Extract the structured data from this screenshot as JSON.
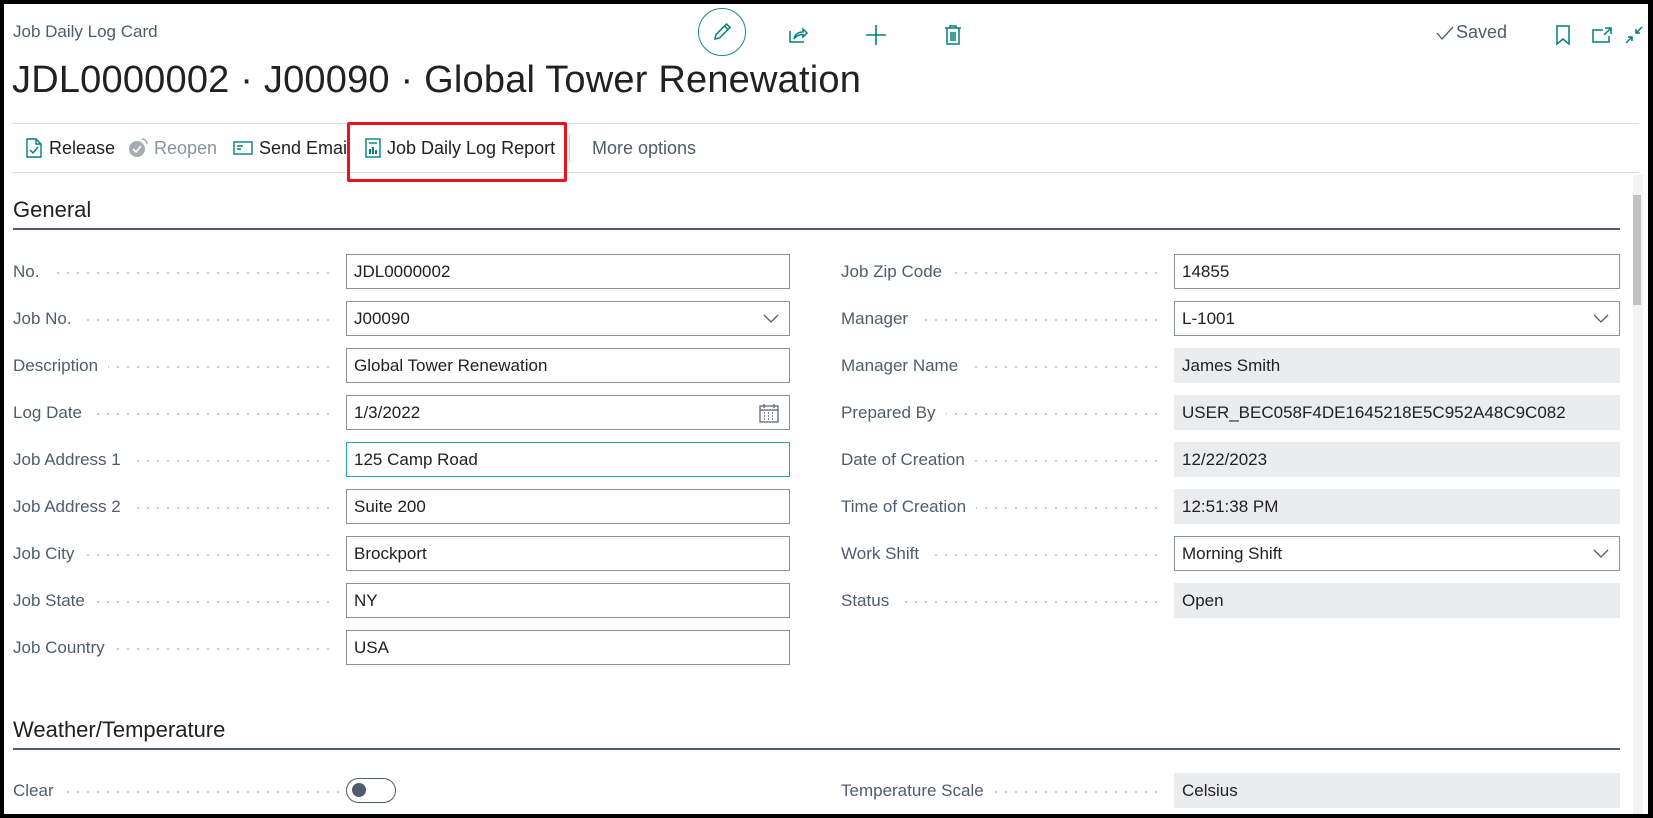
{
  "header": {
    "caption": "Job Daily Log Card",
    "title": "JDL0000002 · J00090 · Global Tower Renewation",
    "save_status": "Saved",
    "icons": {
      "edit": "pencil-icon",
      "share": "share-icon",
      "new": "plus-icon",
      "delete": "trash-icon",
      "bookmark": "bookmark-icon",
      "open_new_window": "open-in-new-window-icon",
      "collapse": "collapse-icon"
    }
  },
  "actions": [
    {
      "label": "Release",
      "icon": "release-document-icon",
      "enabled": true
    },
    {
      "label": "Reopen",
      "icon": "reopen-icon",
      "enabled": false
    },
    {
      "label": "Send Email",
      "icon": "email-icon",
      "enabled": true
    },
    {
      "label": "Job Daily Log Report",
      "icon": "report-icon",
      "enabled": true,
      "highlighted": true
    },
    {
      "label": "More options",
      "enabled": true
    }
  ],
  "highlight_color": "#e8141b",
  "accent_color": "#00807e",
  "sections": {
    "general": {
      "title": "General",
      "left_fields": [
        {
          "label": "No.",
          "value": "JDL0000002",
          "type": "text"
        },
        {
          "label": "Job No.",
          "value": "J00090",
          "type": "dropdown"
        },
        {
          "label": "Description",
          "value": "Global Tower Renewation",
          "type": "text"
        },
        {
          "label": "Log Date",
          "value": "1/3/2022",
          "type": "date"
        },
        {
          "label": "Job Address 1",
          "value": "125 Camp Road",
          "type": "text",
          "focused": true
        },
        {
          "label": "Job Address 2",
          "value": "Suite 200",
          "type": "text"
        },
        {
          "label": "Job City",
          "value": "Brockport",
          "type": "text"
        },
        {
          "label": "Job State",
          "value": "NY",
          "type": "text"
        },
        {
          "label": "Job Country",
          "value": "USA",
          "type": "text"
        }
      ],
      "right_fields": [
        {
          "label": "Job Zip Code",
          "value": "14855",
          "type": "text"
        },
        {
          "label": "Manager",
          "value": "L-1001",
          "type": "dropdown"
        },
        {
          "label": "Manager Name",
          "value": "James Smith",
          "type": "readonly"
        },
        {
          "label": "Prepared By",
          "value": "USER_BEC058F4DE1645218E5C952A48C9C082",
          "type": "readonly"
        },
        {
          "label": "Date of Creation",
          "value": "12/22/2023",
          "type": "readonly"
        },
        {
          "label": "Time of Creation",
          "value": "12:51:38 PM",
          "type": "readonly"
        },
        {
          "label": "Work Shift",
          "value": "Morning Shift",
          "type": "dropdown"
        },
        {
          "label": "Status",
          "value": "Open",
          "type": "readonly"
        }
      ]
    },
    "weather": {
      "title": "Weather/Temperature",
      "left_fields": [
        {
          "label": "Clear",
          "value": false,
          "type": "toggle"
        }
      ],
      "right_fields": [
        {
          "label": "Temperature Scale",
          "value": "Celsius",
          "type": "readonly"
        }
      ]
    }
  }
}
